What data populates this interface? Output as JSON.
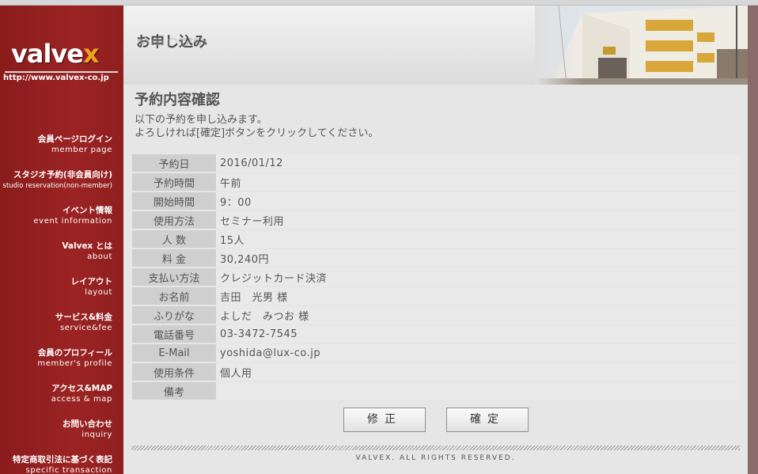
{
  "sidebar": {
    "logo_text": "valvex",
    "url": "http://www.valvex-co.jp",
    "nav": [
      {
        "jp": "会員ページログイン",
        "en": "member page"
      },
      {
        "jp": "スタジオ予約(非会員向け)",
        "en": "studio reservation(non-member)"
      },
      {
        "jp": "イベント情報",
        "en": "event information"
      },
      {
        "jp": "Valvex とは",
        "en": "about"
      },
      {
        "jp": "レイアウト",
        "en": "layout"
      },
      {
        "jp": "サービス&料金",
        "en": "service&fee"
      },
      {
        "jp": "会員のプロフィール",
        "en": "member's profile"
      },
      {
        "jp": "アクセス&MAP",
        "en": "access & map"
      },
      {
        "jp": "お問い合わせ",
        "en": "inquiry"
      },
      {
        "jp": "特定商取引法に基づく表記",
        "en": "specific transaction"
      }
    ]
  },
  "header": {
    "title": "お申し込み"
  },
  "main": {
    "title": "予約内容確認",
    "intro_line1": "以下の予約を申し込みます。",
    "intro_line2": "よろしければ[確定]ボタンをクリックしてください。",
    "rows": [
      {
        "label": "予約日",
        "value": "2016/01/12"
      },
      {
        "label": "予約時間",
        "value": "午前"
      },
      {
        "label": "開始時間",
        "value": "9：00"
      },
      {
        "label": "使用方法",
        "value": "セミナー利用"
      },
      {
        "label": "人 数",
        "value": "15人"
      },
      {
        "label": "料 金",
        "value": "30,240円"
      },
      {
        "label": "支払い方法",
        "value": "クレジットカード決済"
      },
      {
        "label": "お名前",
        "value": "吉田　光男 様"
      },
      {
        "label": "ふりがな",
        "value": "よしだ　みつお 様"
      },
      {
        "label": "電話番号",
        "value": "03-3472-7545"
      },
      {
        "label": "E-Mail",
        "value": "yoshida@lux-co.jp"
      },
      {
        "label": "使用条件",
        "value": "個人用"
      },
      {
        "label": "備考",
        "value": ""
      }
    ],
    "fix_button": "修正",
    "confirm_button": "確定"
  },
  "footer": {
    "copyright": "VALVEX. ALL RIGHTS RESERVED."
  },
  "colors": {
    "sidebar": "#8f1f1f",
    "logo_accent": "#f0a020",
    "label_cell": "#cfcfcf",
    "value_cell": "#e9e9e9"
  }
}
